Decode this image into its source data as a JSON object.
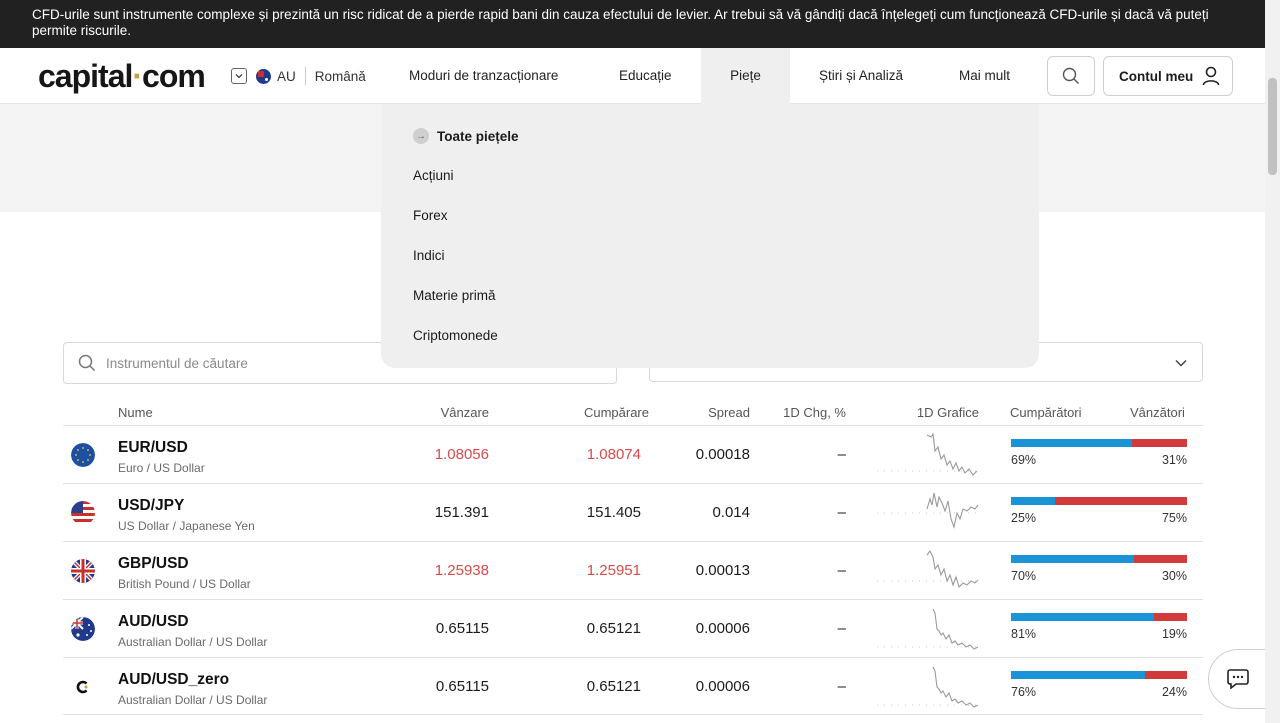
{
  "risk_banner": {
    "text": "CFD-urile sunt instrumente complexe și prezintă un risc ridicat de a pierde rapid bani din cauza efectului de levier. Ar trebui să vă gândiți dacă înțelegeți cum funcționează CFD-urile și dacă vă puteți permite riscurile."
  },
  "header": {
    "logo_main": "capital",
    "logo_dot": "·",
    "logo_tld": "com",
    "region_code": "AU",
    "language": "Română",
    "nav": [
      {
        "label": "Moduri de tranzacționare"
      },
      {
        "label": "Educație"
      },
      {
        "label": "Piețe"
      },
      {
        "label": "Știri și Analiză"
      },
      {
        "label": "Mai mult"
      }
    ],
    "account_label": "Contul meu"
  },
  "markets_menu": {
    "all_label": "Toate piețele",
    "items": [
      "Acțiuni",
      "Forex",
      "Indici",
      "Materie primă",
      "Criptomonede"
    ]
  },
  "search": {
    "placeholder": "Instrumentul de căutare"
  },
  "table": {
    "headers": {
      "name": "Nume",
      "sell": "Vânzare",
      "buy": "Cumpărare",
      "spread": "Spread",
      "change": "1D Chg, %",
      "chart": "1D Grafice",
      "buyers": "Cumpărători",
      "sellers": "Vânzători"
    },
    "rows": [
      {
        "symbol": "EUR/USD",
        "desc": "Euro / US Dollar",
        "sell": "1.08056",
        "buy": "1.08074",
        "spread": "0.00018",
        "change": "–",
        "buyers_pct": "69%",
        "sellers_pct": "31%",
        "buyers": 69,
        "price_red": true
      },
      {
        "symbol": "USD/JPY",
        "desc": "US Dollar / Japanese Yen",
        "sell": "151.391",
        "buy": "151.405",
        "spread": "0.014",
        "change": "–",
        "buyers_pct": "25%",
        "sellers_pct": "75%",
        "buyers": 25,
        "price_red": false
      },
      {
        "symbol": "GBP/USD",
        "desc": "British Pound / US Dollar",
        "sell": "1.25938",
        "buy": "1.25951",
        "spread": "0.00013",
        "change": "–",
        "buyers_pct": "70%",
        "sellers_pct": "30%",
        "buyers": 70,
        "price_red": true
      },
      {
        "symbol": "AUD/USD",
        "desc": "Australian Dollar / US Dollar",
        "sell": "0.65115",
        "buy": "0.65121",
        "spread": "0.00006",
        "change": "–",
        "buyers_pct": "81%",
        "sellers_pct": "19%",
        "buyers": 81,
        "price_red": false
      },
      {
        "symbol": "AUD/USD_zero",
        "desc": "Australian Dollar / US Dollar",
        "sell": "0.65115",
        "buy": "0.65121",
        "spread": "0.00006",
        "change": "–",
        "buyers_pct": "76%",
        "sellers_pct": "24%",
        "buyers": 76,
        "price_red": false
      }
    ]
  },
  "colors": {
    "buyers_bar": "#1a94d6",
    "sellers_bar": "#d13b3b",
    "price_down": "#d94a4a",
    "banner_bg": "#212121"
  },
  "icons": [
    "chevron-down-icon",
    "australia-flag-icon",
    "search-icon",
    "user-icon",
    "arrow-right-icon",
    "chat-icon"
  ]
}
